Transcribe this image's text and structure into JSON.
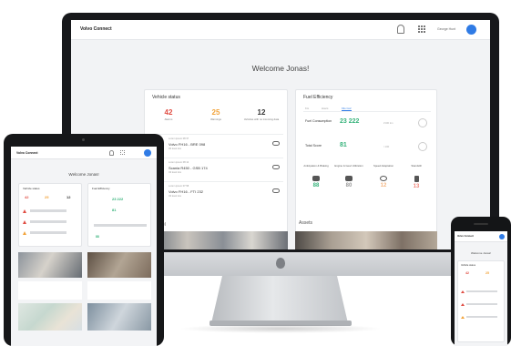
{
  "colors": {
    "accent": "#2f7be5",
    "red": "#e04d43",
    "orange": "#f2a33a",
    "green": "#35b27a"
  },
  "desktop": {
    "app_title": "Volvo Connect",
    "user_name": "George Hunt",
    "welcome": "Welcome Jonas!",
    "vehicle_status": {
      "title": "Vehicle status",
      "stats": [
        {
          "value": "42",
          "label": "Alarms",
          "color": "red"
        },
        {
          "value": "25",
          "label": "Warnings",
          "color": "orange"
        },
        {
          "value": "12",
          "label": "Vehicles with no incoming data",
          "color": "dark"
        }
      ],
      "rows": [
        {
          "time": "Lorem ipsum 08:37",
          "name": "Volvo FH16 - BRE 098",
          "sub": "Oil level low",
          "icon": "red"
        },
        {
          "time": "Lorem ipsum 08:12",
          "name": "Scania R450 - GSB 174",
          "sub": "Oil level low",
          "icon": "red"
        },
        {
          "time": "Lorem ipsum 07:58",
          "name": "Volvo FH16 - FTI 232",
          "sub": "Oil level low",
          "icon": "orange"
        }
      ]
    },
    "fuel_efficiency": {
      "title": "Fuel Efficiency",
      "tabs": [
        "Km",
        "Hours",
        "Kilo Co2"
      ],
      "active_tab": 2,
      "rows": [
        {
          "label": "Fuel Consumption",
          "value": "23 222",
          "unit": "l/100 km"
        },
        {
          "label": "Total Score",
          "value": "81",
          "unit": "/ 100"
        }
      ],
      "behaviours": [
        {
          "label": "Anticipation & Braking",
          "value": "88",
          "color": "green"
        },
        {
          "label": "Engine & Gear Utilization",
          "value": "80",
          "color": "grey"
        },
        {
          "label": "Speed Adaptation",
          "value": "12",
          "color": "lightorange"
        },
        {
          "label": "Standstill",
          "value": "13",
          "color": "pink"
        }
      ]
    },
    "sections": {
      "left": "Fuel",
      "right": "Assets"
    }
  },
  "tablet": {
    "app_title": "Volvo Connect",
    "welcome": "Welcome Jonas!",
    "card_left": "Vehicle status",
    "card_right": "Fuel Efficiency",
    "stats": [
      "42",
      "25",
      "12"
    ],
    "fuel_value": "23 222",
    "score_value": "81"
  },
  "phone": {
    "app_title": "Volvo Connect",
    "welcome": "Welcome Jonas!",
    "card": "Vehicle status",
    "stats": [
      "42",
      "25"
    ]
  }
}
